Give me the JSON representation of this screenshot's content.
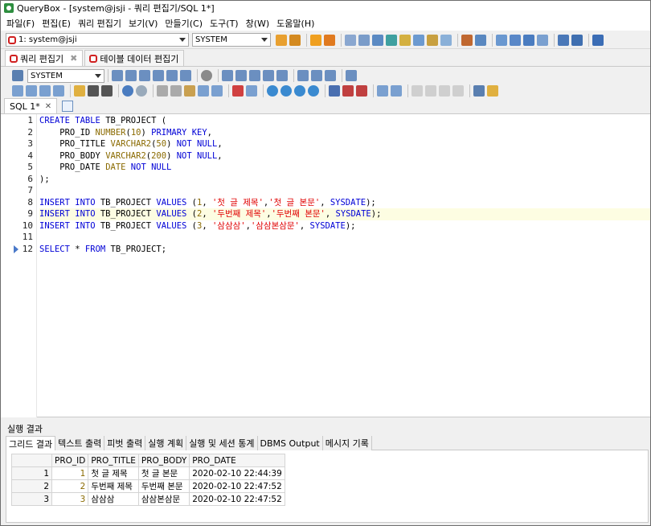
{
  "window": {
    "title": "QueryBox - [system@jsji - 쿼리 편집기/SQL 1*]"
  },
  "menu": [
    "파일(F)",
    "편집(E)",
    "쿼리 편집기",
    "보기(V)",
    "만들기(C)",
    "도구(T)",
    "창(W)",
    "도움말(H)"
  ],
  "connection": {
    "selected": "1: system@jsji",
    "schema": "SYSTEM"
  },
  "editor_tabs": [
    {
      "label": "쿼리 편집기"
    },
    {
      "label": "테이블 데이터 편집기"
    }
  ],
  "schema_combo": "SYSTEM",
  "sql_tab": {
    "label": "SQL 1*",
    "close": "✕"
  },
  "code_lines": [
    {
      "n": "1",
      "tokens": [
        [
          "kw",
          "CREATE TABLE "
        ],
        [
          "",
          "TB_PROJECT ("
        ]
      ]
    },
    {
      "n": "2",
      "tokens": [
        [
          "",
          "    PRO_ID "
        ],
        [
          "typ",
          "NUMBER"
        ],
        [
          "",
          "("
        ],
        [
          "num",
          "10"
        ],
        [
          "",
          ") "
        ],
        [
          "kw",
          "PRIMARY KEY"
        ],
        [
          "",
          ","
        ]
      ]
    },
    {
      "n": "3",
      "tokens": [
        [
          "",
          "    PRO_TITLE "
        ],
        [
          "typ",
          "VARCHAR2"
        ],
        [
          "",
          "("
        ],
        [
          "num",
          "50"
        ],
        [
          "",
          ") "
        ],
        [
          "kw",
          "NOT NULL"
        ],
        [
          "",
          ","
        ]
      ]
    },
    {
      "n": "4",
      "tokens": [
        [
          "",
          "    PRO_BODY "
        ],
        [
          "typ",
          "VARCHAR2"
        ],
        [
          "",
          "("
        ],
        [
          "num",
          "200"
        ],
        [
          "",
          ") "
        ],
        [
          "kw",
          "NOT NULL"
        ],
        [
          "",
          ","
        ]
      ]
    },
    {
      "n": "5",
      "tokens": [
        [
          "",
          "    PRO_DATE "
        ],
        [
          "typ",
          "DATE "
        ],
        [
          "kw",
          "NOT NULL"
        ]
      ]
    },
    {
      "n": "6",
      "tokens": [
        [
          "",
          ");"
        ]
      ]
    },
    {
      "n": "7",
      "tokens": []
    },
    {
      "n": "8",
      "tokens": [
        [
          "kw",
          "INSERT INTO "
        ],
        [
          "",
          "TB_PROJECT "
        ],
        [
          "kw",
          "VALUES "
        ],
        [
          "",
          "("
        ],
        [
          "num",
          "1"
        ],
        [
          "",
          ", "
        ],
        [
          "str",
          "'첫 글 제목'"
        ],
        [
          "",
          ","
        ],
        [
          "str",
          "'첫 글 본문'"
        ],
        [
          "",
          ", "
        ],
        [
          "kw",
          "SYSDATE"
        ],
        [
          "",
          ");"
        ]
      ]
    },
    {
      "n": "9",
      "tokens": [
        [
          "kw",
          "INSERT INTO "
        ],
        [
          "",
          "TB_PROJECT "
        ],
        [
          "kw",
          "VALUES "
        ],
        [
          "",
          "("
        ],
        [
          "num",
          "2"
        ],
        [
          "",
          ", "
        ],
        [
          "str",
          "'두번째 제목'"
        ],
        [
          "",
          ","
        ],
        [
          "str",
          "'두번째 본문'"
        ],
        [
          "",
          ", "
        ],
        [
          "kw",
          "SYSDATE"
        ],
        [
          "",
          ");"
        ]
      ],
      "highlight": true
    },
    {
      "n": "10",
      "tokens": [
        [
          "kw",
          "INSERT INTO "
        ],
        [
          "",
          "TB_PROJECT "
        ],
        [
          "kw",
          "VALUES "
        ],
        [
          "",
          "("
        ],
        [
          "num",
          "3"
        ],
        [
          "",
          ", "
        ],
        [
          "str",
          "'삼삼삼'"
        ],
        [
          "",
          ","
        ],
        [
          "str",
          "'삼삼본삼문'"
        ],
        [
          "",
          ", "
        ],
        [
          "kw",
          "SYSDATE"
        ],
        [
          "",
          ");"
        ]
      ]
    },
    {
      "n": "11",
      "tokens": []
    },
    {
      "n": "12",
      "tokens": [
        [
          "kw",
          "SELECT "
        ],
        [
          "",
          "* "
        ],
        [
          "kw",
          "FROM "
        ],
        [
          "",
          "TB_PROJECT;"
        ]
      ],
      "marker": true
    }
  ],
  "results": {
    "label": "실행 결과",
    "tabs": [
      "그리드 결과",
      "텍스트 출력",
      "피벗 출력",
      "실행 계획",
      "실행 및 세션 통계",
      "DBMS Output",
      "메시지 기록"
    ],
    "columns": [
      "",
      "PRO_ID",
      "PRO_TITLE",
      "PRO_BODY",
      "PRO_DATE"
    ],
    "rows": [
      [
        "1",
        "1",
        "첫 글 제목",
        "첫 글 본문",
        "2020-02-10 22:44:39"
      ],
      [
        "2",
        "2",
        "두번째 제목",
        "두번째 본문",
        "2020-02-10 22:47:52"
      ],
      [
        "3",
        "3",
        "삼삼삼",
        "삼삼본삼문",
        "2020-02-10 22:47:52"
      ]
    ]
  },
  "colors": {
    "keyword": "#0000d6",
    "string": "#e00000",
    "number": "#8a6a00",
    "highlight_line": "#fdfde2"
  }
}
